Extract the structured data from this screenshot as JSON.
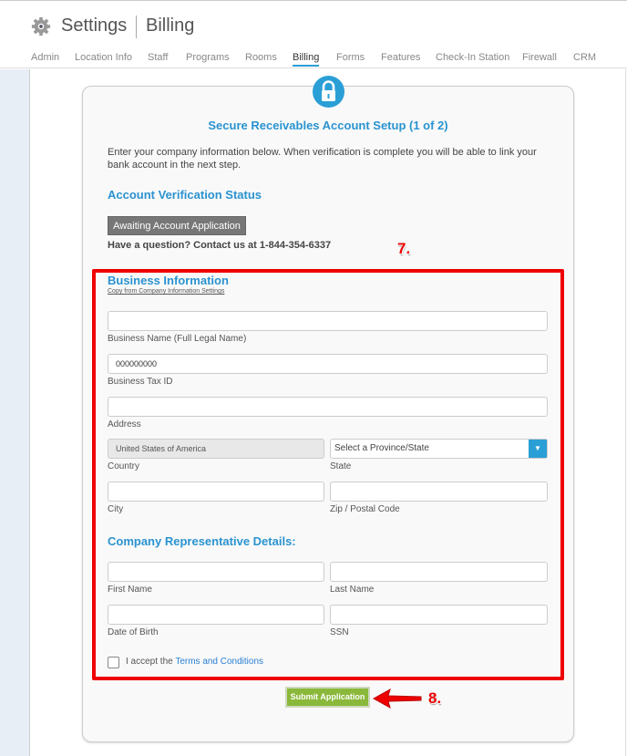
{
  "header": {
    "title": "Settings",
    "section": "Billing",
    "icon": "gear-icon"
  },
  "tabs": [
    {
      "label": "Admin"
    },
    {
      "label": "Location Info"
    },
    {
      "label": "Staff"
    },
    {
      "label": "Programs"
    },
    {
      "label": "Rooms"
    },
    {
      "label": "Billing",
      "active": true
    },
    {
      "label": "Forms"
    },
    {
      "label": "Features"
    },
    {
      "label": "Check-In Station"
    },
    {
      "label": "Firewall"
    },
    {
      "label": "CRM"
    }
  ],
  "card": {
    "icon": "lock-icon",
    "title": "Secure Receivables Account Setup (1 of 2)",
    "intro": "Enter your company information below. When verification is complete you will be able to link your bank account in the next step.",
    "verification_heading": "Account Verification Status",
    "status_button": "Awaiting Account Application",
    "question": "Have a question? Contact us at 1-844-354-6337"
  },
  "business": {
    "heading": "Business Information",
    "copy_link": "Copy from Company Information Settings",
    "fields": {
      "name": {
        "label": "Business Name (Full Legal Name)",
        "value": ""
      },
      "tax_id": {
        "label": "Business Tax ID",
        "value": "000000000"
      },
      "address": {
        "label": "Address",
        "value": ""
      },
      "country": {
        "label": "Country",
        "value": "United States of America"
      },
      "state": {
        "label": "State",
        "value": "Select a Province/State"
      },
      "city": {
        "label": "City",
        "value": ""
      },
      "zip": {
        "label": "Zip / Postal Code",
        "value": ""
      }
    }
  },
  "representative": {
    "heading": "Company Representative Details:",
    "fields": {
      "first": {
        "label": "First Name",
        "value": ""
      },
      "last": {
        "label": "Last Name",
        "value": ""
      },
      "dob": {
        "label": "Date of Birth",
        "value": ""
      },
      "ssn": {
        "label": "SSN",
        "value": ""
      }
    }
  },
  "terms": {
    "prefix": "I accept the",
    "link": "Terms and Conditions",
    "checked": false
  },
  "submit_label": "Submit Application",
  "annotations": {
    "step7": "7.",
    "step8": "8.",
    "color": "#ee0000"
  },
  "colors": {
    "accent": "#2a9fd6",
    "submit": "#8ab83a",
    "status_button": "#777777"
  }
}
